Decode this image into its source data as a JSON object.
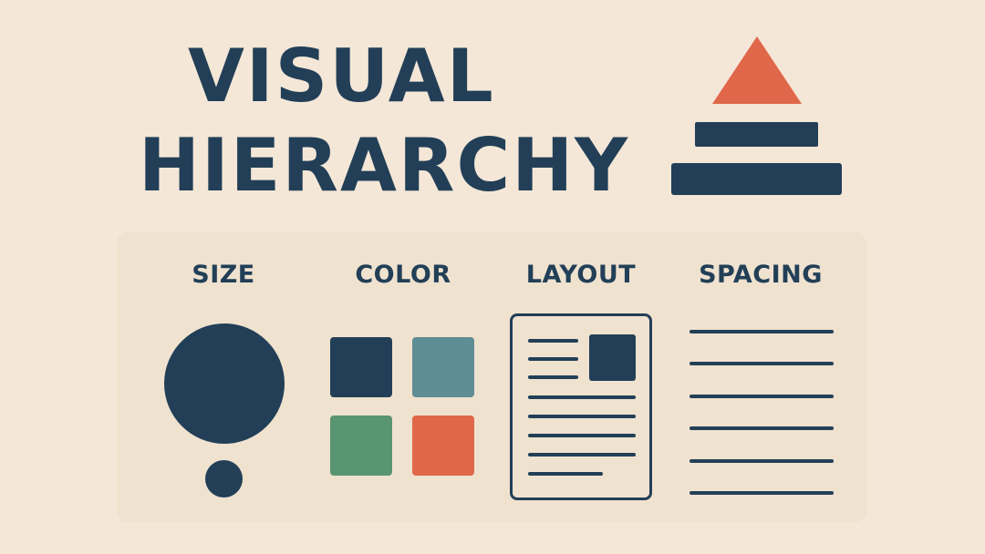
{
  "title": {
    "line1": "VISUAL",
    "line2": "HIERARCHY"
  },
  "columns": [
    {
      "label": "SIZE"
    },
    {
      "label": "COLOR"
    },
    {
      "label": "LAYOUT"
    },
    {
      "label": "SPACING"
    }
  ],
  "colors": {
    "background": "#f4e7d7",
    "panel": "#efe2cf",
    "navy": "#223f57",
    "teal": "#5f8d94",
    "green": "#5a9572",
    "orange": "#e0674a"
  },
  "icons": {
    "pyramid": "hierarchy-pyramid-icon",
    "size": "circles-size-icon",
    "color": "color-swatches-icon",
    "layout": "document-layout-icon",
    "spacing": "spaced-lines-icon"
  }
}
